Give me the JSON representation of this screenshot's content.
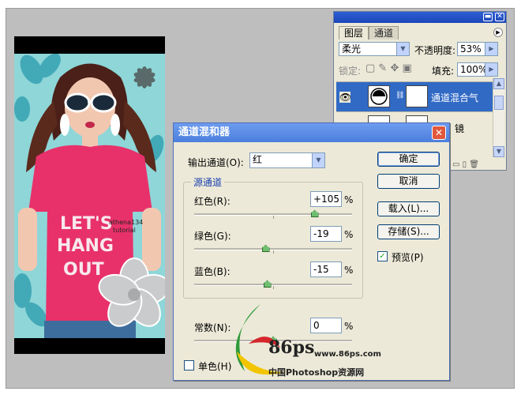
{
  "photo": {
    "watermark": [
      "athena134",
      "tutorial"
    ],
    "shirt_text": [
      "LET'S",
      "HANG",
      "OUT"
    ]
  },
  "layers_panel": {
    "tabs": [
      "图层",
      "通道"
    ],
    "blend_mode": "柔光",
    "opacity_label": "不透明度:",
    "opacity_value": "53%",
    "lock_label": "锁定:",
    "fill_label": "填充:",
    "fill_value": "100%",
    "layers": [
      {
        "name": "通道混合气",
        "selected": true
      },
      {
        "name": "镜",
        "selected": false
      }
    ]
  },
  "dialog": {
    "title": "通道混和器",
    "output_channel_label": "输出通道(O):",
    "output_channel_value": "红",
    "source_group_label": "源通道",
    "red_label": "红色(R):",
    "red_value": "+105",
    "red_level": 105,
    "green_label": "绿色(G):",
    "green_value": "-19",
    "green_level": -19,
    "blue_label": "蓝色(B):",
    "blue_value": "-15",
    "blue_level": -15,
    "constant_label": "常数(N):",
    "constant_value": "0",
    "constant_level": 0,
    "percent": "%",
    "monochrome_label": "单色(H)",
    "monochrome_checked": false,
    "preview_label": "预览(P)",
    "preview_checked": true,
    "buttons": {
      "ok": "确定",
      "cancel": "取消",
      "load": "载入(L)...",
      "save": "存储(S)..."
    }
  },
  "logo": {
    "brand": "86ps",
    "url": "www.86ps.com",
    "caption": "中国Photoshop资源网"
  },
  "colors": {
    "accent_blue": "#316ac5",
    "title_blue": "#4b7fdc",
    "photo_bg": "#8ed6d8",
    "shirt_pink": "#e8316a"
  }
}
